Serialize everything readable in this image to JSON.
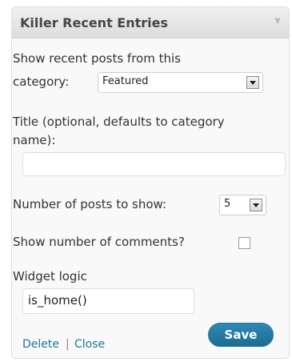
{
  "widget": {
    "title": "Killer Recent Entries",
    "category_label_line1": "Show recent posts from this",
    "category_label_line2": "category:",
    "category_value": "Featured",
    "title_label_line1": "Title (optional, defaults to category",
    "title_label_line2": "name):",
    "title_value": "",
    "num_posts_label": "Number of posts to show:",
    "num_posts_value": "5",
    "show_comments_label": "Show number of comments?",
    "show_comments_checked": false,
    "widget_logic_label": "Widget logic",
    "widget_logic_value": "is_home()",
    "delete_label": "Delete",
    "separator": "|",
    "close_label": "Close",
    "save_label": "Save"
  },
  "colors": {
    "link": "#21759b",
    "save_button": "#21759b"
  }
}
